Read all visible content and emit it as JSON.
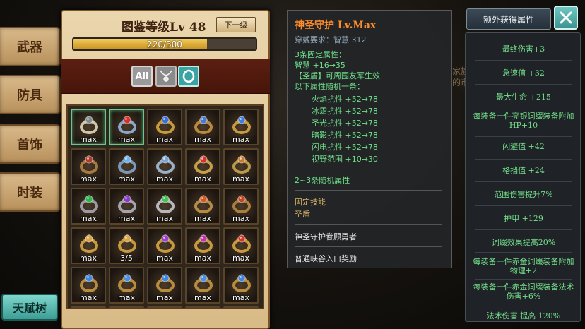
{
  "background": {
    "text_lines": [
      "家族提供",
      "的市场"
    ]
  },
  "side_tabs": [
    {
      "label": "武器"
    },
    {
      "label": "防具"
    },
    {
      "label": "首饰"
    },
    {
      "label": "时装"
    }
  ],
  "talent_button": {
    "label": "天赋树"
  },
  "collection": {
    "level_title": "图鉴等级Lv  48",
    "next_level_button": "下一级",
    "progress": {
      "text": "220/300",
      "current": 220,
      "max": 300
    },
    "filters": [
      {
        "name": "all",
        "label": "All",
        "selected": false
      },
      {
        "name": "necklace",
        "icon": "necklace-icon",
        "selected": false
      },
      {
        "name": "ring",
        "icon": "ring-icon",
        "selected": true
      }
    ],
    "items": [
      {
        "caption": "max",
        "gem": "#7f8c8a",
        "band": "#cfc6a9",
        "highlight": true
      },
      {
        "caption": "max",
        "gem": "#d0342c",
        "band": "#8aa7c9",
        "highlight": true
      },
      {
        "caption": "max",
        "gem": "#3b6fd8",
        "band": "#c79a3a",
        "highlight": false
      },
      {
        "caption": "max",
        "gem": "#4a78d0",
        "band": "#b98a3c",
        "highlight": false
      },
      {
        "caption": "max",
        "gem": "#3f7ee0",
        "band": "#c59a40",
        "highlight": false
      },
      {
        "caption": "max",
        "gem": "#b03a2e",
        "band": "#a57a44",
        "highlight": false
      },
      {
        "caption": "max",
        "gem": "#6fb3e8",
        "band": "#7a98b8",
        "highlight": false
      },
      {
        "caption": "max",
        "gem": "#7aa6d6",
        "band": "#9ab0c8",
        "highlight": false
      },
      {
        "caption": "max",
        "gem": "#d8322a",
        "band": "#c4a04a",
        "highlight": false
      },
      {
        "caption": "max",
        "gem": "#cf7a2a",
        "band": "#b99a48",
        "highlight": false
      },
      {
        "caption": "max",
        "gem": "#2fb34a",
        "band": "#9a9aa4",
        "highlight": false
      },
      {
        "caption": "max",
        "gem": "#8b3fc9",
        "band": "#a4a4ae",
        "highlight": false
      },
      {
        "caption": "max",
        "gem": "#46c25a",
        "band": "#b7b7c0",
        "highlight": false
      },
      {
        "caption": "max",
        "gem": "#d35b2b",
        "band": "#b68c44",
        "highlight": false
      },
      {
        "caption": "max",
        "gem": "#c04a28",
        "band": "#a97e3c",
        "highlight": false
      },
      {
        "caption": "max",
        "gem": "#d9a64a",
        "band": "#c89a40",
        "highlight": false
      },
      {
        "caption": "3/5",
        "gem": "#d9a64a",
        "band": "#c69a3e",
        "highlight": false
      },
      {
        "caption": "max",
        "gem": "#9b3fd3",
        "band": "#c79a40",
        "highlight": false
      },
      {
        "caption": "max",
        "gem": "#c035a8",
        "band": "#c79a40",
        "highlight": false
      },
      {
        "caption": "max",
        "gem": "#d8342c",
        "band": "#c79a40",
        "highlight": false
      },
      {
        "caption": "max",
        "gem": "#3f86e0",
        "band": "#b78c3e",
        "highlight": false
      },
      {
        "caption": "max",
        "gem": "#4a8fe0",
        "band": "#b78c3e",
        "highlight": false
      },
      {
        "caption": "max",
        "gem": "#3f86e0",
        "band": "#b78c3e",
        "highlight": false
      },
      {
        "caption": "max",
        "gem": "#4a8fe0",
        "band": "#b78c3e",
        "highlight": false
      },
      {
        "caption": "max",
        "gem": "#3f86e0",
        "band": "#b78c3e",
        "highlight": false
      },
      {
        "caption": "",
        "gem": "#3f86e0",
        "band": "#b78c3e",
        "highlight": false
      },
      {
        "caption": "",
        "gem": "#3f86e0",
        "band": "#b78c3e",
        "highlight": false
      },
      {
        "caption": "",
        "gem": "#3f86e0",
        "band": "#b78c3e",
        "highlight": false
      },
      {
        "caption": "",
        "gem": "#3f86e0",
        "band": "#b78c3e",
        "highlight": false
      },
      {
        "caption": "",
        "gem": "#3f86e0",
        "band": "#b78c3e",
        "highlight": false
      }
    ]
  },
  "tooltip": {
    "name": "神圣守护 Lv.Max",
    "requirement": "穿戴要求：智慧 312",
    "fixed_title": "3条固定属性：",
    "fixed_attrs": [
      "智慧 +16→35",
      "【圣盾】可周围友军生效"
    ],
    "random_title": "以下属性随机一条：",
    "random_attrs": [
      "火焰抗性 +52→78",
      "冰霜抗性 +52→78",
      "圣光抗性 +52→78",
      "暗影抗性 +52→78",
      "闪电抗性 +52→78",
      "视野范围 +10→30"
    ],
    "random_count": "2~3条随机属性",
    "skill_title": "固定技能",
    "skill_name": "圣盾",
    "source_1": "神圣守护眷顾勇者",
    "source_2": "普通峡谷入口奖励"
  },
  "extra_attrs": {
    "button_label": "额外获得属性",
    "items": [
      "最终伤害+3",
      "急速值 +32",
      "最大生命 +215",
      "每装备一件亮银词缀装备附加HP+10",
      "闪避值 +42",
      "格挡值 +24",
      "范围伤害提升7%",
      "护甲 +129",
      "词缀效果提高20%",
      "每装备一件赤金词缀装备附加物理+2",
      "每装备一件赤金词缀装备法术伤害+6%",
      "法术伤害 提高 120%"
    ]
  },
  "colors": {
    "tooltip_title": "#ff8c2b",
    "attr_green": "#74e08c",
    "requirement": "#8fa4b4",
    "progress_fill": "#f2cc5d",
    "accent_teal": "#3b948f"
  }
}
